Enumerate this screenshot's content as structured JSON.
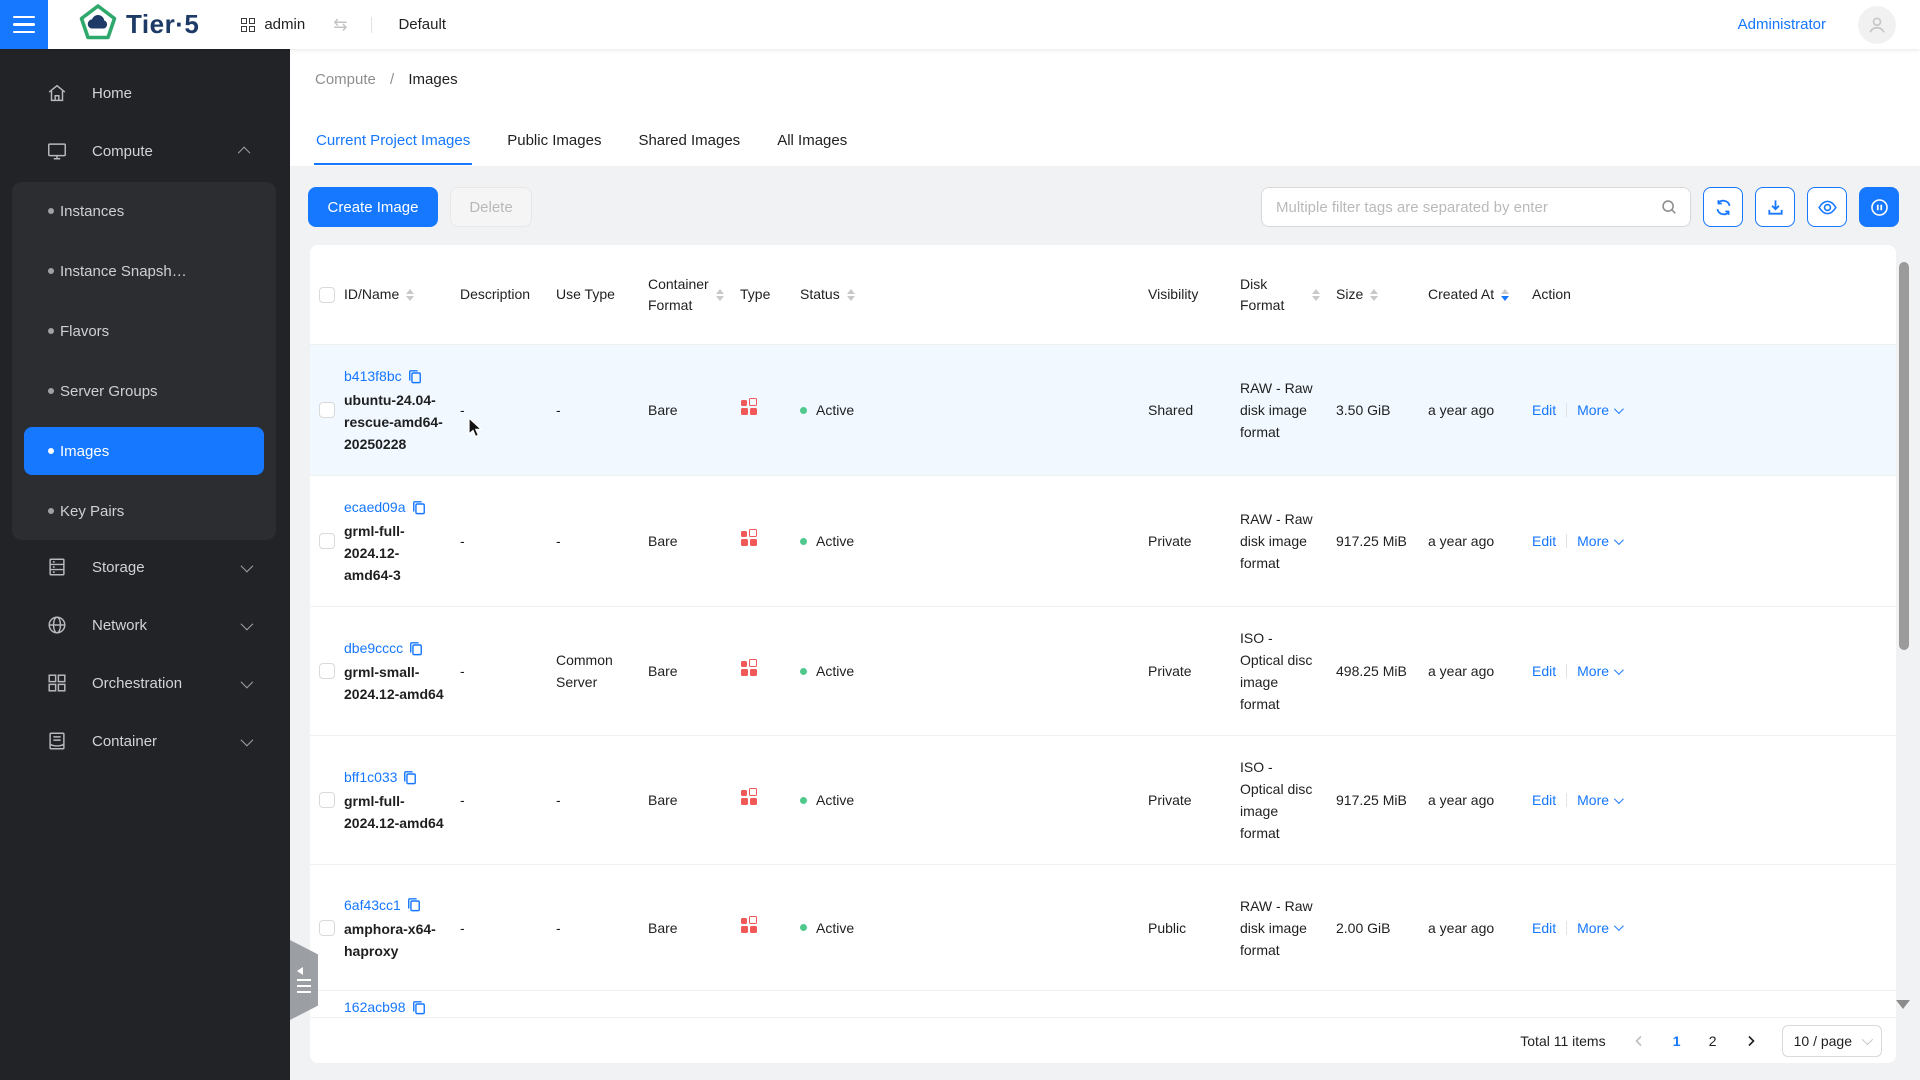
{
  "topbar": {
    "brand": "Tier·5",
    "workspace": "admin",
    "project": "Default",
    "user_link": "Administrator"
  },
  "breadcrumb": {
    "section": "Compute",
    "separator": "/",
    "current": "Images"
  },
  "tabs": [
    {
      "label": "Current Project Images",
      "active": true
    },
    {
      "label": "Public Images",
      "active": false
    },
    {
      "label": "Shared Images",
      "active": false
    },
    {
      "label": "All Images",
      "active": false
    }
  ],
  "toolbar": {
    "create_label": "Create Image",
    "delete_label": "Delete",
    "filter_placeholder": "Multiple filter tags are separated by enter"
  },
  "sidebar": {
    "items": [
      {
        "label": "Home",
        "icon": "home-icon",
        "chevron": null
      },
      {
        "label": "Compute",
        "icon": "compute-icon",
        "chevron": "up",
        "expanded": true,
        "children": [
          {
            "label": "Instances",
            "selected": false
          },
          {
            "label": "Instance Snapsh…",
            "selected": false
          },
          {
            "label": "Flavors",
            "selected": false
          },
          {
            "label": "Server Groups",
            "selected": false
          },
          {
            "label": "Images",
            "selected": true
          },
          {
            "label": "Key Pairs",
            "selected": false
          }
        ]
      },
      {
        "label": "Storage",
        "icon": "storage-icon",
        "chevron": "down"
      },
      {
        "label": "Network",
        "icon": "network-icon",
        "chevron": "down"
      },
      {
        "label": "Orchestration",
        "icon": "orchestration-icon",
        "chevron": "down"
      },
      {
        "label": "Container",
        "icon": "container-icon",
        "chevron": "down"
      }
    ]
  },
  "table": {
    "columns": [
      {
        "key": "select",
        "type": "checkbox",
        "label": ""
      },
      {
        "key": "id_name",
        "label": "ID/Name",
        "sortable": true
      },
      {
        "key": "description",
        "label": "Description"
      },
      {
        "key": "use_type",
        "label": "Use Type"
      },
      {
        "key": "container_format",
        "label": "Container Format",
        "sortable": true
      },
      {
        "key": "type",
        "label": "Type"
      },
      {
        "key": "status",
        "label": "Status",
        "sortable": true
      },
      {
        "key": "visibility",
        "label": "Visibility"
      },
      {
        "key": "disk_format",
        "label": "Disk Format",
        "sortable": true
      },
      {
        "key": "size",
        "label": "Size",
        "sortable": true
      },
      {
        "key": "created_at",
        "label": "Created At",
        "sortable": true,
        "sorted": "desc"
      },
      {
        "key": "action",
        "label": "Action"
      }
    ],
    "action_labels": {
      "edit": "Edit",
      "more": "More"
    },
    "rows": [
      {
        "id": "b413f8bc",
        "name": "ubuntu-24.04-rescue-amd64-20250228",
        "description": "-",
        "use_type": "-",
        "container_format": "Bare",
        "status": "Active",
        "visibility": "Shared",
        "disk_format": "RAW - Raw disk image format",
        "size": "3.50 GiB",
        "created_at": "a year ago",
        "highlighted": true,
        "partial": false
      },
      {
        "id": "ecaed09a",
        "name": "grml-full-2024.12-amd64-3",
        "description": "-",
        "use_type": "-",
        "container_format": "Bare",
        "status": "Active",
        "visibility": "Private",
        "disk_format": "RAW - Raw disk image format",
        "size": "917.25 MiB",
        "created_at": "a year ago",
        "highlighted": false,
        "partial": false
      },
      {
        "id": "dbe9cccc",
        "name": "grml-small-2024.12-amd64",
        "description": "-",
        "use_type": "Common Server",
        "container_format": "Bare",
        "status": "Active",
        "visibility": "Private",
        "disk_format": "ISO - Optical disc image format",
        "size": "498.25 MiB",
        "created_at": "a year ago",
        "highlighted": false,
        "partial": false
      },
      {
        "id": "bff1c033",
        "name": "grml-full-2024.12-amd64",
        "description": "-",
        "use_type": "-",
        "container_format": "Bare",
        "status": "Active",
        "visibility": "Private",
        "disk_format": "ISO - Optical disc image format",
        "size": "917.25 MiB",
        "created_at": "a year ago",
        "highlighted": false,
        "partial": false
      },
      {
        "id": "6af43cc1",
        "name": "amphora-x64-haproxy",
        "description": "-",
        "use_type": "-",
        "container_format": "Bare",
        "status": "Active",
        "visibility": "Public",
        "disk_format": "RAW - Raw disk image format",
        "size": "2.00 GiB",
        "created_at": "a year ago",
        "highlighted": false,
        "partial": false
      },
      {
        "id": "162acb98",
        "name": "",
        "description": "",
        "use_type": "",
        "container_format": "",
        "status": "",
        "visibility": "",
        "disk_format": "",
        "size": "",
        "created_at": "",
        "highlighted": false,
        "partial": true
      }
    ]
  },
  "footer": {
    "total": "Total 11 items",
    "pages": [
      "1",
      "2"
    ],
    "current_page": "1",
    "page_size": "10 / page"
  },
  "colors": {
    "accent": "#1677ff",
    "status_active": "#4fc98c",
    "type_icon": "#f15959",
    "sidebar_bg": "#212327",
    "selected_bg": "#1677ff",
    "row_highlight": "#f1f8ff"
  }
}
